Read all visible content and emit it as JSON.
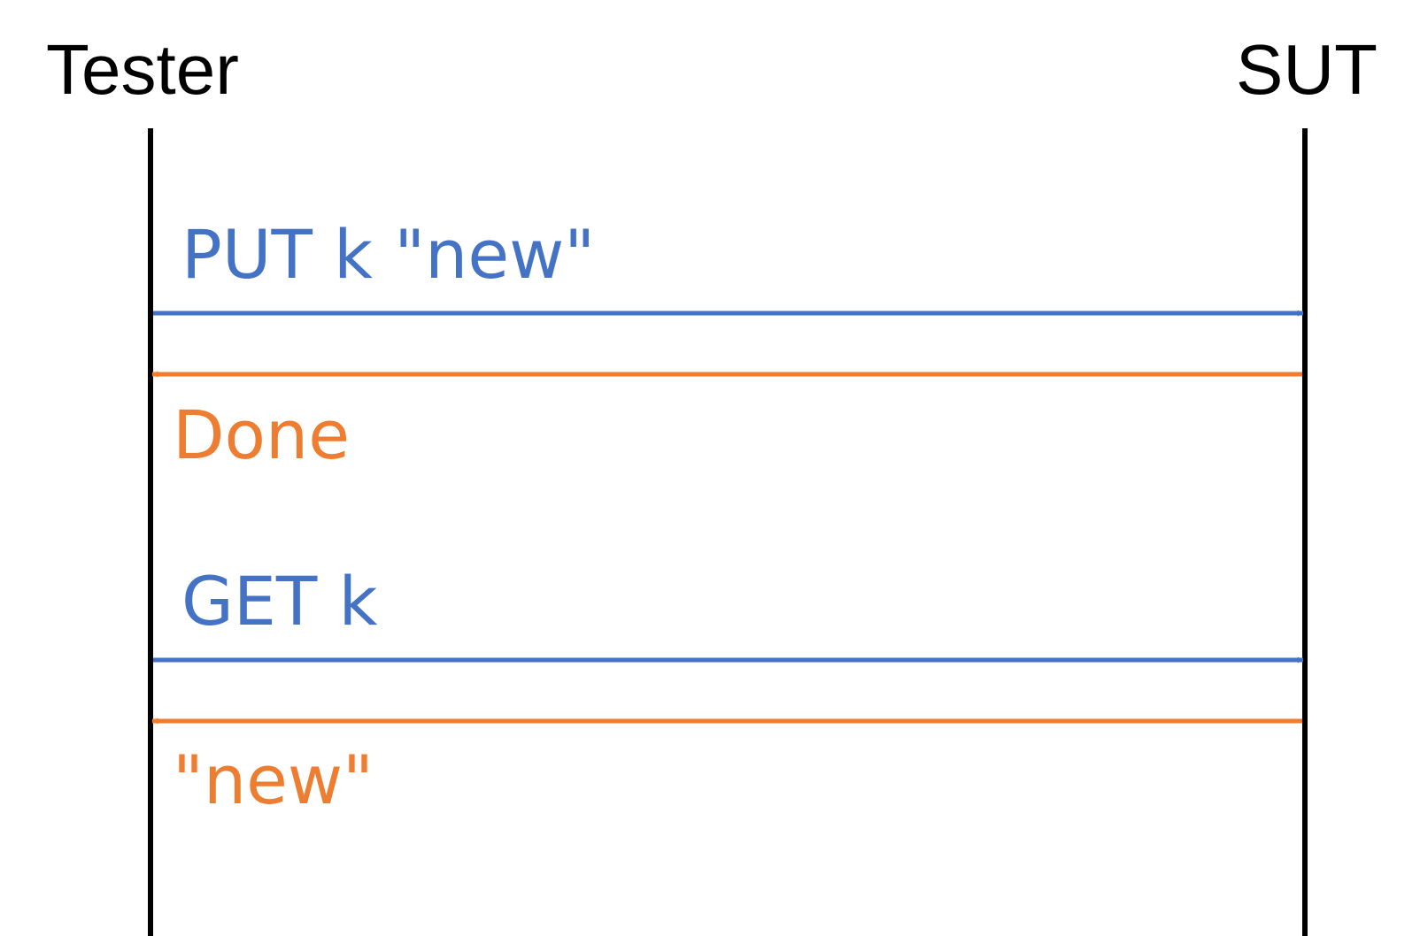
{
  "colors": {
    "request": "#4472C4",
    "response": "#ED7D31",
    "lifeline": "#000000",
    "background": "#FFFFFF"
  },
  "actors": {
    "left": "Tester",
    "right": "SUT"
  },
  "messages": [
    {
      "label": "PUT k \"new\"",
      "direction": "to-sut",
      "kind": "request"
    },
    {
      "label": "Done",
      "direction": "to-tester",
      "kind": "response"
    },
    {
      "label": "GET k",
      "direction": "to-sut",
      "kind": "request"
    },
    {
      "label": "\"new\"",
      "direction": "to-tester",
      "kind": "response"
    }
  ]
}
